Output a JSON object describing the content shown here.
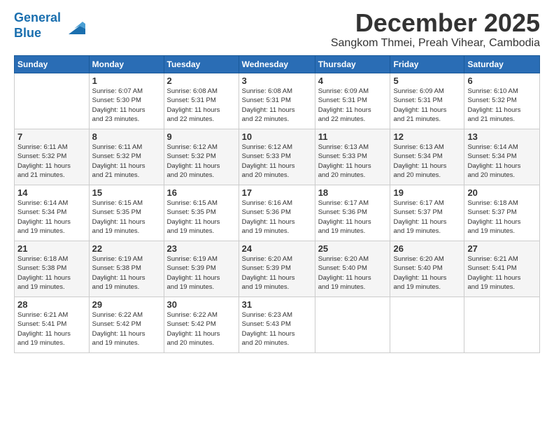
{
  "logo": {
    "line1": "General",
    "line2": "Blue"
  },
  "title": "December 2025",
  "location": "Sangkom Thmei, Preah Vihear, Cambodia",
  "weekdays": [
    "Sunday",
    "Monday",
    "Tuesday",
    "Wednesday",
    "Thursday",
    "Friday",
    "Saturday"
  ],
  "weeks": [
    [
      {
        "day": "",
        "sunrise": "",
        "sunset": "",
        "daylight": ""
      },
      {
        "day": "1",
        "sunrise": "Sunrise: 6:07 AM",
        "sunset": "Sunset: 5:30 PM",
        "daylight": "Daylight: 11 hours and 23 minutes."
      },
      {
        "day": "2",
        "sunrise": "Sunrise: 6:08 AM",
        "sunset": "Sunset: 5:31 PM",
        "daylight": "Daylight: 11 hours and 22 minutes."
      },
      {
        "day": "3",
        "sunrise": "Sunrise: 6:08 AM",
        "sunset": "Sunset: 5:31 PM",
        "daylight": "Daylight: 11 hours and 22 minutes."
      },
      {
        "day": "4",
        "sunrise": "Sunrise: 6:09 AM",
        "sunset": "Sunset: 5:31 PM",
        "daylight": "Daylight: 11 hours and 22 minutes."
      },
      {
        "day": "5",
        "sunrise": "Sunrise: 6:09 AM",
        "sunset": "Sunset: 5:31 PM",
        "daylight": "Daylight: 11 hours and 21 minutes."
      },
      {
        "day": "6",
        "sunrise": "Sunrise: 6:10 AM",
        "sunset": "Sunset: 5:32 PM",
        "daylight": "Daylight: 11 hours and 21 minutes."
      }
    ],
    [
      {
        "day": "7",
        "sunrise": "Sunrise: 6:11 AM",
        "sunset": "Sunset: 5:32 PM",
        "daylight": "Daylight: 11 hours and 21 minutes."
      },
      {
        "day": "8",
        "sunrise": "Sunrise: 6:11 AM",
        "sunset": "Sunset: 5:32 PM",
        "daylight": "Daylight: 11 hours and 21 minutes."
      },
      {
        "day": "9",
        "sunrise": "Sunrise: 6:12 AM",
        "sunset": "Sunset: 5:32 PM",
        "daylight": "Daylight: 11 hours and 20 minutes."
      },
      {
        "day": "10",
        "sunrise": "Sunrise: 6:12 AM",
        "sunset": "Sunset: 5:33 PM",
        "daylight": "Daylight: 11 hours and 20 minutes."
      },
      {
        "day": "11",
        "sunrise": "Sunrise: 6:13 AM",
        "sunset": "Sunset: 5:33 PM",
        "daylight": "Daylight: 11 hours and 20 minutes."
      },
      {
        "day": "12",
        "sunrise": "Sunrise: 6:13 AM",
        "sunset": "Sunset: 5:34 PM",
        "daylight": "Daylight: 11 hours and 20 minutes."
      },
      {
        "day": "13",
        "sunrise": "Sunrise: 6:14 AM",
        "sunset": "Sunset: 5:34 PM",
        "daylight": "Daylight: 11 hours and 20 minutes."
      }
    ],
    [
      {
        "day": "14",
        "sunrise": "Sunrise: 6:14 AM",
        "sunset": "Sunset: 5:34 PM",
        "daylight": "Daylight: 11 hours and 19 minutes."
      },
      {
        "day": "15",
        "sunrise": "Sunrise: 6:15 AM",
        "sunset": "Sunset: 5:35 PM",
        "daylight": "Daylight: 11 hours and 19 minutes."
      },
      {
        "day": "16",
        "sunrise": "Sunrise: 6:15 AM",
        "sunset": "Sunset: 5:35 PM",
        "daylight": "Daylight: 11 hours and 19 minutes."
      },
      {
        "day": "17",
        "sunrise": "Sunrise: 6:16 AM",
        "sunset": "Sunset: 5:36 PM",
        "daylight": "Daylight: 11 hours and 19 minutes."
      },
      {
        "day": "18",
        "sunrise": "Sunrise: 6:17 AM",
        "sunset": "Sunset: 5:36 PM",
        "daylight": "Daylight: 11 hours and 19 minutes."
      },
      {
        "day": "19",
        "sunrise": "Sunrise: 6:17 AM",
        "sunset": "Sunset: 5:37 PM",
        "daylight": "Daylight: 11 hours and 19 minutes."
      },
      {
        "day": "20",
        "sunrise": "Sunrise: 6:18 AM",
        "sunset": "Sunset: 5:37 PM",
        "daylight": "Daylight: 11 hours and 19 minutes."
      }
    ],
    [
      {
        "day": "21",
        "sunrise": "Sunrise: 6:18 AM",
        "sunset": "Sunset: 5:38 PM",
        "daylight": "Daylight: 11 hours and 19 minutes."
      },
      {
        "day": "22",
        "sunrise": "Sunrise: 6:19 AM",
        "sunset": "Sunset: 5:38 PM",
        "daylight": "Daylight: 11 hours and 19 minutes."
      },
      {
        "day": "23",
        "sunrise": "Sunrise: 6:19 AM",
        "sunset": "Sunset: 5:39 PM",
        "daylight": "Daylight: 11 hours and 19 minutes."
      },
      {
        "day": "24",
        "sunrise": "Sunrise: 6:20 AM",
        "sunset": "Sunset: 5:39 PM",
        "daylight": "Daylight: 11 hours and 19 minutes."
      },
      {
        "day": "25",
        "sunrise": "Sunrise: 6:20 AM",
        "sunset": "Sunset: 5:40 PM",
        "daylight": "Daylight: 11 hours and 19 minutes."
      },
      {
        "day": "26",
        "sunrise": "Sunrise: 6:20 AM",
        "sunset": "Sunset: 5:40 PM",
        "daylight": "Daylight: 11 hours and 19 minutes."
      },
      {
        "day": "27",
        "sunrise": "Sunrise: 6:21 AM",
        "sunset": "Sunset: 5:41 PM",
        "daylight": "Daylight: 11 hours and 19 minutes."
      }
    ],
    [
      {
        "day": "28",
        "sunrise": "Sunrise: 6:21 AM",
        "sunset": "Sunset: 5:41 PM",
        "daylight": "Daylight: 11 hours and 19 minutes."
      },
      {
        "day": "29",
        "sunrise": "Sunrise: 6:22 AM",
        "sunset": "Sunset: 5:42 PM",
        "daylight": "Daylight: 11 hours and 19 minutes."
      },
      {
        "day": "30",
        "sunrise": "Sunrise: 6:22 AM",
        "sunset": "Sunset: 5:42 PM",
        "daylight": "Daylight: 11 hours and 20 minutes."
      },
      {
        "day": "31",
        "sunrise": "Sunrise: 6:23 AM",
        "sunset": "Sunset: 5:43 PM",
        "daylight": "Daylight: 11 hours and 20 minutes."
      },
      {
        "day": "",
        "sunrise": "",
        "sunset": "",
        "daylight": ""
      },
      {
        "day": "",
        "sunrise": "",
        "sunset": "",
        "daylight": ""
      },
      {
        "day": "",
        "sunrise": "",
        "sunset": "",
        "daylight": ""
      }
    ]
  ]
}
